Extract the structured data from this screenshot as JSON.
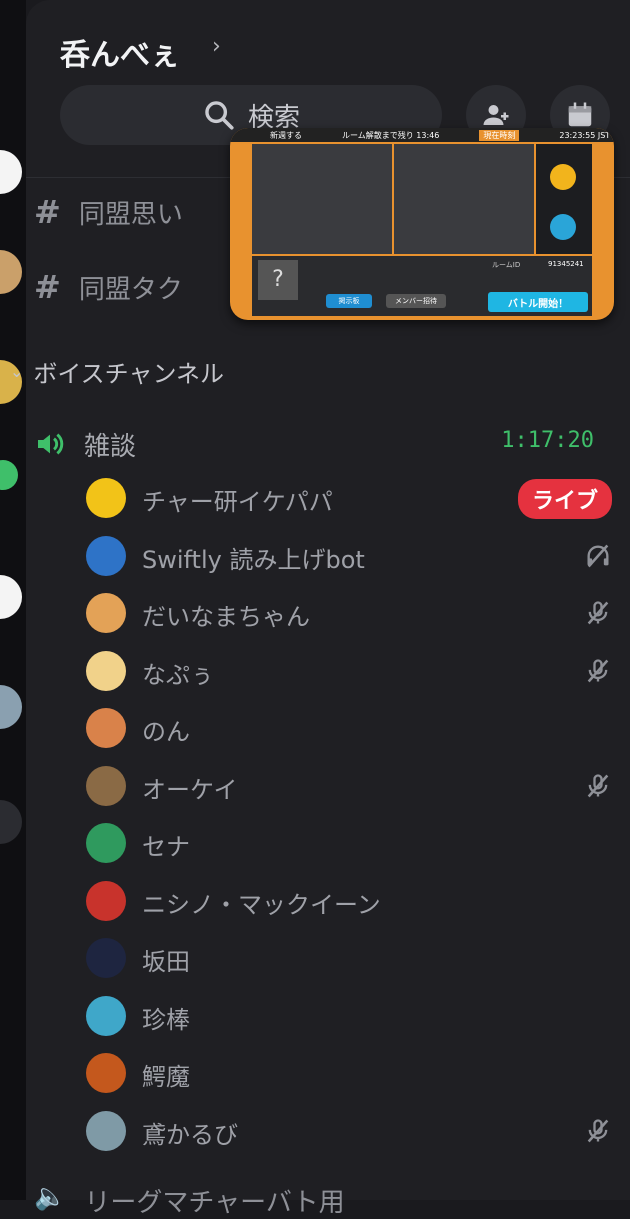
{
  "server": {
    "name": "呑んべぇ"
  },
  "search": {
    "label": "検索"
  },
  "text_channels": [
    {
      "name": "同盟思い"
    },
    {
      "name": "同盟タク"
    }
  ],
  "category": {
    "name": "ボイスチャンネル"
  },
  "voice_channel": {
    "name": "雑談",
    "duration": "1:17:20"
  },
  "members": [
    {
      "name": "チャー研イケパパ",
      "badge": "ライブ",
      "avatar_color": "#f2c318"
    },
    {
      "name": "Swiftly 読み上げbot",
      "status_icon": "deafened-icon",
      "avatar_color": "#2e73c7"
    },
    {
      "name": "だいなまちゃん",
      "status_icon": "muted-mic-icon",
      "avatar_color": "#e3a257"
    },
    {
      "name": "なぷぅ",
      "status_icon": "muted-mic-icon",
      "avatar_color": "#f1d28a"
    },
    {
      "name": "のん",
      "avatar_color": "#d9824a"
    },
    {
      "name": "オーケイ",
      "status_icon": "muted-mic-icon",
      "avatar_color": "#8a6a45"
    },
    {
      "name": "セナ",
      "avatar_color": "#2f9a5e"
    },
    {
      "name": "ニシノ・マックイーン",
      "avatar_color": "#c8332c"
    },
    {
      "name": "坂田",
      "avatar_color": "#1e2540"
    },
    {
      "name": "珍棒",
      "avatar_color": "#3fa7c9"
    },
    {
      "name": "鰐魔",
      "avatar_color": "#c4581d"
    },
    {
      "name": "鳶かるび",
      "status_icon": "muted-mic-icon",
      "avatar_color": "#7f9aa6"
    }
  ],
  "bottom_channel": {
    "name": "リーグマチャーバト用"
  },
  "pip": {
    "header_left": "新週する",
    "header_center": "ルーム解散まで残り 13:46",
    "header_right_label": "現在時刻",
    "time": "23:23:55 JST",
    "room_id_label": "ルームID",
    "room_id": "91345241",
    "battle_button": "バトル開始！",
    "invite_button": "メンバー招待",
    "board_button": "掲示板"
  },
  "colors": {
    "accent_green": "#3fbf6a",
    "live_red": "#e5323f",
    "background": "#1f1f23"
  }
}
